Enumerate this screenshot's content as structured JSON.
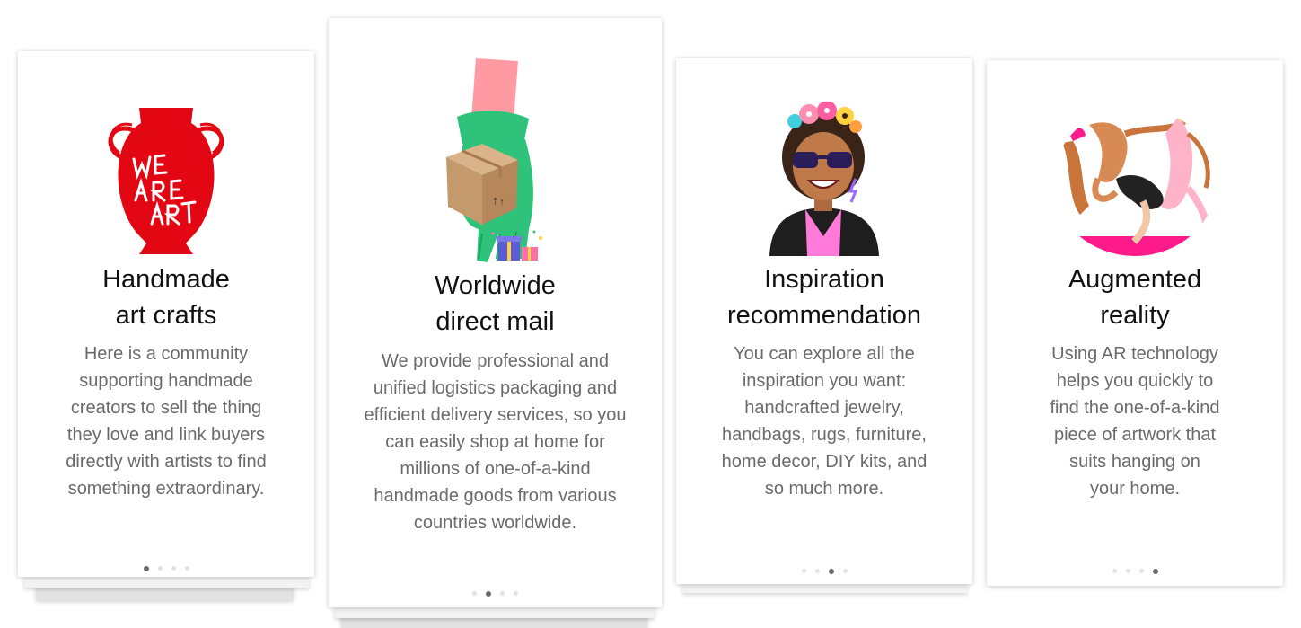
{
  "cards": [
    {
      "title_line1": "Handmade",
      "title_line2": "art crafts",
      "description": "Here is a community supporting handmade creators to sell the thing they love and link buyers directly with artists to find something extraordinary.",
      "illustration": "red-vase-illustration",
      "vase_text": [
        "WE",
        "ARE",
        "ART"
      ],
      "active_dot": 0
    },
    {
      "title_line1": "Worldwide",
      "title_line2": "direct mail",
      "description": "We provide professional and unified logistics packaging and efficient delivery services, so you can easily shop at home for millions of one-of-a-kind handmade goods from various countries worldwide.",
      "illustration": "gloved-hand-with-package-illustration",
      "active_dot": 1
    },
    {
      "title_line1": "Inspiration",
      "title_line2": "recommendation",
      "description": "You can explore all the inspiration you want: handcrafted jewelry, handbags, rugs, furniture, home decor, DIY kits, and so much more.",
      "illustration": "woman-with-flower-crown-illustration",
      "active_dot": 2
    },
    {
      "title_line1": "Augmented",
      "title_line2": "reality",
      "description": "Using AR technology helps you quickly to find the one-of-a-kind piece of artwork that suits hanging on your home.",
      "illustration": "dancing-figures-artwork-illustration",
      "active_dot": 3
    }
  ],
  "colors": {
    "vase_red": "#e30613",
    "glove_green": "#2fc27a",
    "sleeve_pink": "#ff9aa2",
    "box_brown": "#c49a6c",
    "title_text": "#111111",
    "body_text": "#6a6a6a",
    "dot_active": "#6b6b6b",
    "dot_inactive": "#e2e2e2"
  }
}
